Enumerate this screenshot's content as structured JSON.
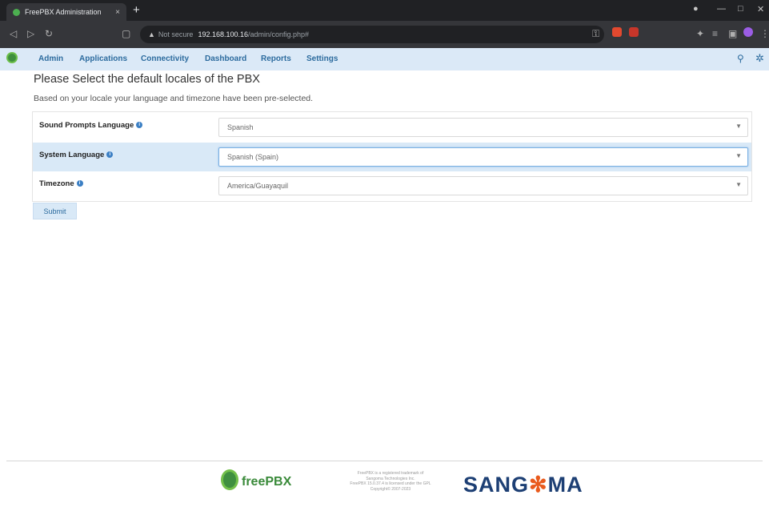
{
  "browser": {
    "tab_title": "FreePBX Administration",
    "tab_close": "×",
    "new_tab": "+",
    "url_security": "Not secure",
    "url_host": "192.168.100.16",
    "url_path": "/admin/config.php#",
    "window_controls": [
      "—",
      "□",
      "✕"
    ]
  },
  "nav": {
    "items": [
      "Admin",
      "Applications",
      "Connectivity",
      "Dashboard",
      "Reports",
      "Settings"
    ]
  },
  "page": {
    "title": "Please Select the default locales of the PBX",
    "subtitle": "Based on your locale your language and timezone have been pre-selected."
  },
  "form": {
    "fields": [
      {
        "label": "Sound Prompts Language",
        "value": "Spanish"
      },
      {
        "label": "System Language",
        "value": "Spanish (Spain)"
      },
      {
        "label": "Timezone",
        "value": "America/Guayaquil"
      }
    ],
    "help_glyph": "i",
    "submit_label": "Submit"
  },
  "footer": {
    "freepbx_label": "freePBX",
    "legal_lines": [
      "FreePBX is a registered trademark of",
      "Sangoma Technologies Inc.",
      "FreePBX 15.0.37.4 is licensed under the GPL",
      "Copyright© 2007-2023"
    ],
    "sangoma_left": "SANG",
    "sangoma_star": "✻",
    "sangoma_right": "MA"
  },
  "colors": {
    "nav_bg": "#dbe9f7",
    "link": "#2c6b9e",
    "freepbx_green": "#3a8a3a",
    "sangoma_blue": "#1d3f74",
    "sangoma_orange": "#e95a1c"
  }
}
